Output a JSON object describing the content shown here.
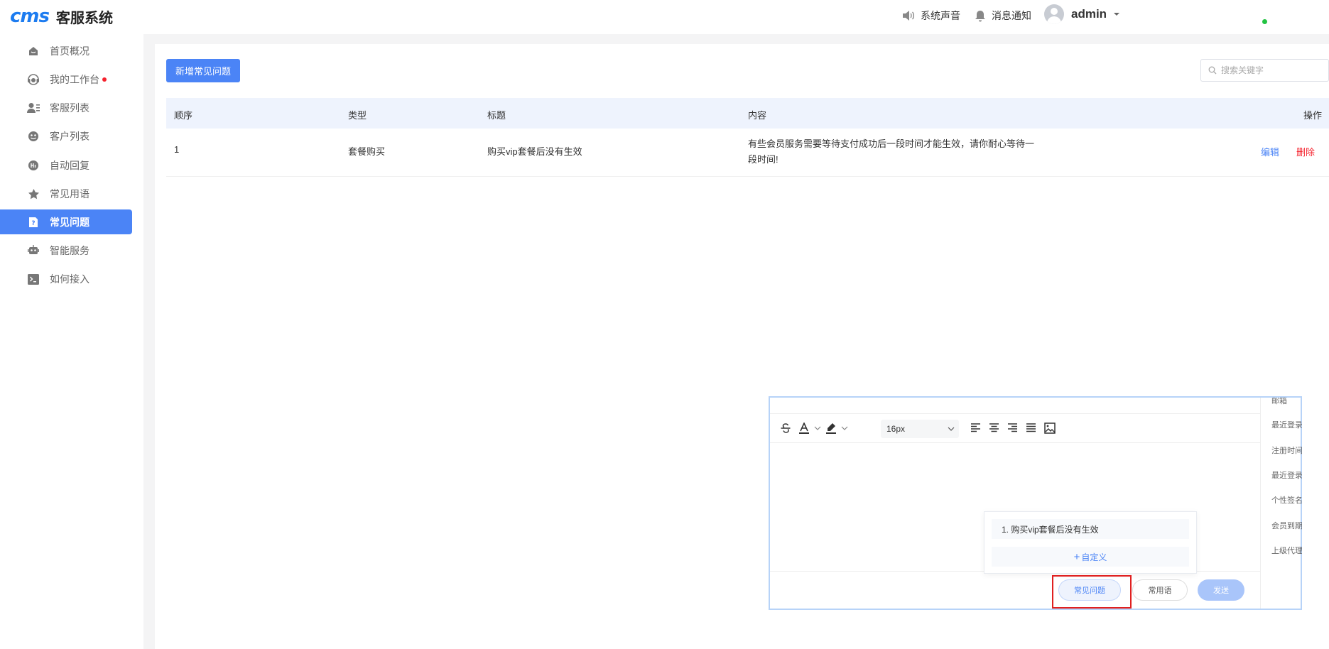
{
  "brand": {
    "logo_mark": "cms",
    "title": "客服系统"
  },
  "header": {
    "sound_label": "系统声音",
    "notify_label": "消息通知",
    "user_name": "admin"
  },
  "sidebar": {
    "items": [
      {
        "label": "首页概况",
        "icon": "home-icon"
      },
      {
        "label": "我的工作台",
        "icon": "headset-icon",
        "badge": true
      },
      {
        "label": "客服列表",
        "icon": "agent-list-icon"
      },
      {
        "label": "客户列表",
        "icon": "customer-icon"
      },
      {
        "label": "自动回复",
        "icon": "auto-reply-icon"
      },
      {
        "label": "常见用语",
        "icon": "star-icon"
      },
      {
        "label": "常见问题",
        "icon": "question-icon",
        "active": true
      },
      {
        "label": "智能服务",
        "icon": "robot-icon"
      },
      {
        "label": "如何接入",
        "icon": "terminal-icon"
      }
    ]
  },
  "toolbar": {
    "add_label": "新增常见问题",
    "search_placeholder": "搜索关键字"
  },
  "table": {
    "columns": [
      "顺序",
      "类型",
      "标题",
      "内容",
      "操作"
    ],
    "rows": [
      {
        "order": "1",
        "type": "套餐购买",
        "title": "购买vip套餐后没有生效",
        "content": "有些会员服务需要等待支付成功后一段时间才能生效，请你耐心等待一段时间!",
        "edit": "编辑",
        "delete": "删除"
      }
    ]
  },
  "editor": {
    "font_size": "16px",
    "info_labels": [
      "邮箱",
      "最近登录",
      "注册时间",
      "最近登录",
      "个性签名",
      "会员到期",
      "上级代理"
    ],
    "faq_popup": {
      "item": "1. 购买vip套餐后没有生效",
      "custom_label": "自定义"
    },
    "buttons": {
      "faq": "常见问题",
      "common": "常用语",
      "send": "发送"
    }
  },
  "colors": {
    "accent": "#4b84f6",
    "danger": "#f5222d",
    "online": "#23c343"
  }
}
